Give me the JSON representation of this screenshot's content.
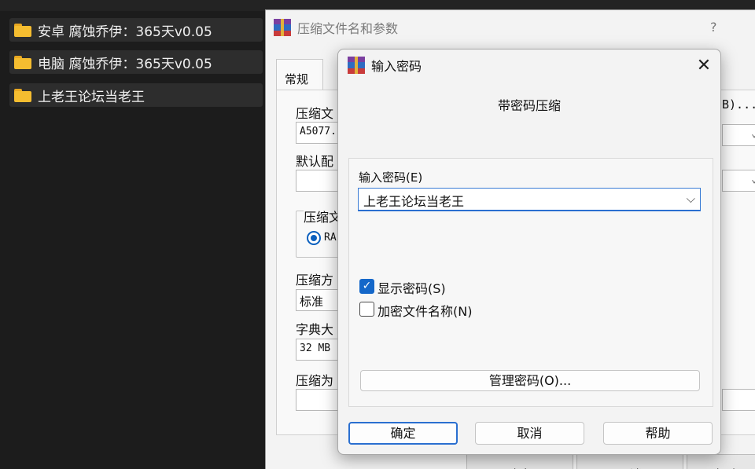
{
  "explorer": {
    "folders": [
      {
        "name": "安卓 腐蚀乔伊：365天v0.05"
      },
      {
        "name": "电脑 腐蚀乔伊：365天v0.05"
      },
      {
        "name": "上老王论坛当老王"
      }
    ]
  },
  "archive_dialog": {
    "title": "压缩文件名和参数",
    "help": "?",
    "tab_general": "常规",
    "archive_name_label": "压缩文",
    "archive_name_value": "A5077.",
    "browse_partial": "B)...",
    "default_profile_label": "默认配",
    "archive_format_label": "压缩文",
    "format_option": "RA",
    "method_label": "压缩方",
    "method_value": "标准",
    "dictionary_label": "字典大",
    "dictionary_value": "32 MB",
    "split_label": "压缩为",
    "buttons": {
      "ok": "确定",
      "cancel": "取消",
      "help": "帮助"
    }
  },
  "password_dialog": {
    "title": "输入密码",
    "close": "✕",
    "header": "带密码压缩",
    "password_label": "输入密码(E)",
    "password_value": "上老王论坛当老王",
    "show_password_label": "显示密码(S)",
    "show_password_checked": true,
    "encrypt_names_label": "加密文件名称(N)",
    "encrypt_names_checked": false,
    "manage_button": "管理密码(O)...",
    "buttons": {
      "ok": "确定",
      "cancel": "取消",
      "help": "帮助"
    }
  },
  "colors": {
    "accent": "#2a6fd0",
    "folder": "#f5bd30",
    "dark_bg": "#1c1c1c"
  }
}
